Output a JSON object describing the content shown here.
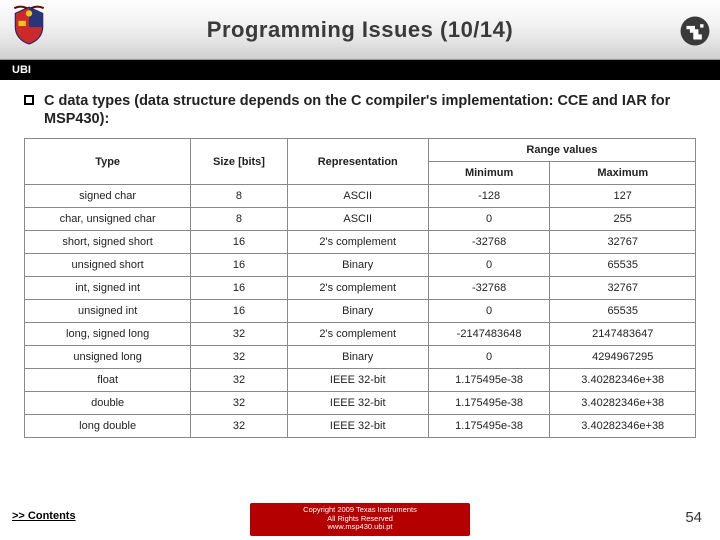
{
  "header": {
    "title": "Programming Issues (10/14)",
    "ubi_label": "UBI"
  },
  "bullet_text": "C data types (data structure depends on the C compiler's implementation: CCE and IAR for MSP430):",
  "chart_data": {
    "type": "table",
    "columns": [
      "Type",
      "Size [bits]",
      "Representation",
      "Minimum",
      "Maximum"
    ],
    "header_top": {
      "range_label": "Range values"
    },
    "rows": [
      {
        "type": "signed char",
        "size": "8",
        "repr": "ASCII",
        "min": "-128",
        "max": "127"
      },
      {
        "type": "char, unsigned char",
        "size": "8",
        "repr": "ASCII",
        "min": "0",
        "max": "255"
      },
      {
        "type": "short, signed short",
        "size": "16",
        "repr": "2's complement",
        "min": "-32768",
        "max": "32767"
      },
      {
        "type": "unsigned short",
        "size": "16",
        "repr": "Binary",
        "min": "0",
        "max": "65535"
      },
      {
        "type": "int, signed int",
        "size": "16",
        "repr": "2's complement",
        "min": "-32768",
        "max": "32767"
      },
      {
        "type": "unsigned int",
        "size": "16",
        "repr": "Binary",
        "min": "0",
        "max": "65535"
      },
      {
        "type": "long, signed long",
        "size": "32",
        "repr": "2's complement",
        "min": "-2147483648",
        "max": "2147483647"
      },
      {
        "type": "unsigned long",
        "size": "32",
        "repr": "Binary",
        "min": "0",
        "max": "4294967295"
      },
      {
        "type": "float",
        "size": "32",
        "repr": "IEEE 32-bit",
        "min": "1.175495e-38",
        "max": "3.40282346e+38"
      },
      {
        "type": "double",
        "size": "32",
        "repr": "IEEE 32-bit",
        "min": "1.175495e-38",
        "max": "3.40282346e+38"
      },
      {
        "type": "long double",
        "size": "32",
        "repr": "IEEE 32-bit",
        "min": "1.175495e-38",
        "max": "3.40282346e+38"
      }
    ]
  },
  "footer": {
    "contents_link": ">> Contents",
    "copyright_line1": "Copyright 2009 Texas Instruments",
    "copyright_line2": "All Rights Reserved",
    "website": "www.msp430.ubi.pt",
    "page_number": "54"
  }
}
